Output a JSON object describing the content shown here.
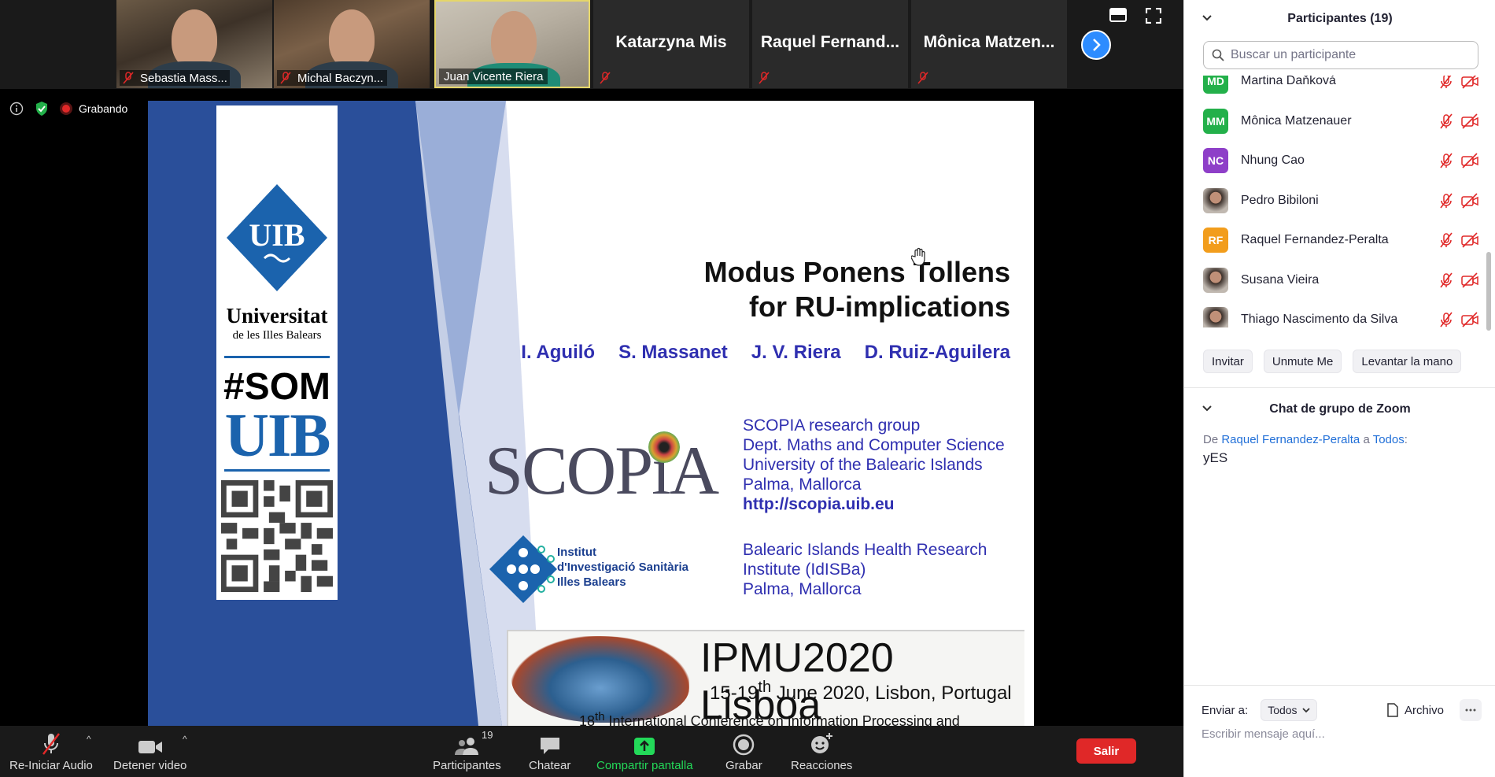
{
  "thumbnails": [
    {
      "name": "Sebastia Mass...",
      "type": "video"
    },
    {
      "name": "Michal Baczyn...",
      "type": "video"
    },
    {
      "name": "Juan Vicente Riera",
      "type": "video",
      "active": true
    },
    {
      "name": "Katarzyna Mis",
      "type": "name"
    },
    {
      "name": "Raquel  Fernand...",
      "type": "name"
    },
    {
      "name": "Mônica  Matzen...",
      "type": "name"
    }
  ],
  "status": {
    "recording_label": "Grabando"
  },
  "slide": {
    "uib_title": "Universitat",
    "uib_subtitle": "de les Illes Balears",
    "uib_badge": "UIB",
    "som_tag": "#SOM",
    "som_uib": "UIB",
    "title_line1": "Modus Ponens Tollens",
    "title_line2": "for RU-implications",
    "authors": [
      "I. Aguiló",
      "S. Massanet",
      "J. V. Riera",
      "D. Ruiz-Aguilera"
    ],
    "scopia_logo": "SCOPiA",
    "scopia_lines": [
      "SCOPIA research group",
      "Dept. Maths and Computer Science",
      "University of the Balearic Islands",
      "Palma, Mallorca"
    ],
    "scopia_url": "http://scopia.uib.eu",
    "idisba_label": [
      "Institut",
      "d'Investigació Sanitària",
      "Illes Balears"
    ],
    "idisba_lines": [
      "Balearic  Islands  Health  Research",
      "Institute (IdISBa)",
      "Palma, Mallorca"
    ],
    "ipmu_title": "IPMU2020 Lisboa",
    "ipmu_date_pre": "15-19",
    "ipmu_date_sup": "th",
    "ipmu_date_post": " June 2020, Lisbon, Portugal",
    "ipmu_conf_pre": "18",
    "ipmu_conf_sup": "th",
    "ipmu_conf_post": " International Conference on Information Processing and"
  },
  "toolbar": {
    "audio_label": "Re-Iniciar Audio",
    "video_label": "Detener video",
    "participants_label": "Participantes",
    "participants_count": "19",
    "chat_label": "Chatear",
    "share_label": "Compartir pantalla",
    "record_label": "Grabar",
    "reactions_label": "Reacciones",
    "leave_label": "Salir"
  },
  "panel": {
    "participants_title": "Participantes (19)",
    "search_placeholder": "Buscar un participante",
    "participants": [
      {
        "initials": "MD",
        "name": "Martina Daňková",
        "color": "#23b04a"
      },
      {
        "initials": "MM",
        "name": "Mônica Matzenauer",
        "color": "#23b04a"
      },
      {
        "initials": "NC",
        "name": "Nhung Cao",
        "color": "#8e3fc8"
      },
      {
        "initials": "",
        "name": "Pedro Bibiloni",
        "color": "photo"
      },
      {
        "initials": "RF",
        "name": "Raquel Fernandez-Peralta",
        "color": "#f29d1c"
      },
      {
        "initials": "",
        "name": "Susana Vieira",
        "color": "photo"
      },
      {
        "initials": "",
        "name": "Thiago Nascimento da Silva",
        "color": "photo"
      }
    ],
    "buttons": [
      "Invitar",
      "Unmute Me",
      "Levantar la mano"
    ],
    "chat_title": "Chat de grupo de Zoom",
    "chat_from_prefix": "De ",
    "chat_from": "Raquel Fernandez-Peralta",
    "chat_to_prefix": " a ",
    "chat_to": "Todos",
    "chat_to_suffix": ":",
    "chat_message": "yES",
    "send_to_label": "Enviar a:",
    "send_to_value": "Todos",
    "file_label": "Archivo",
    "message_placeholder": "Escribir mensaje aquí..."
  }
}
